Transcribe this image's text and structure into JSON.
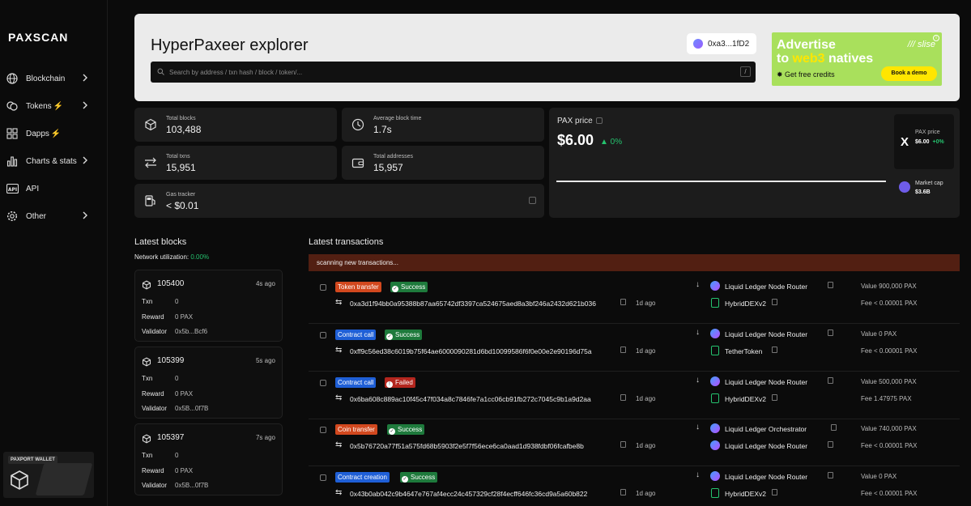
{
  "app": {
    "logo": "PAXSCAN"
  },
  "sidebar": {
    "items": [
      {
        "label": "Blockchain",
        "icon": "globe-icon",
        "bolt": "",
        "chevron": true
      },
      {
        "label": "Tokens",
        "icon": "coins-icon",
        "bolt": "⚡",
        "chevron": true
      },
      {
        "label": "Dapps",
        "icon": "grid-icon",
        "bolt": "⚡",
        "chevron": false
      },
      {
        "label": "Charts & stats",
        "icon": "bar-chart-icon",
        "bolt": "",
        "chevron": true
      },
      {
        "label": "API",
        "icon": "api-icon",
        "bolt": "",
        "chevron": false
      },
      {
        "label": "Other",
        "icon": "gear-icon",
        "bolt": "",
        "chevron": true
      }
    ],
    "promo_tag": "PAXPORT WALLET"
  },
  "header": {
    "title": "HyperPaxeer explorer",
    "search_placeholder": "Search by address / txn hash / block / token/...",
    "search_shortcut": "/",
    "wallet": "0xa3...1fD2"
  },
  "ad": {
    "line1": "Advertise",
    "line2_pre": "to ",
    "line2_hl": "web3",
    "line2_post": " natives",
    "brand": "/// slise",
    "credits": "✸ Get free credits",
    "button": "Book a demo"
  },
  "stats": {
    "total_blocks": {
      "label": "Total blocks",
      "value": "103,488"
    },
    "avg_block_time": {
      "label": "Average block time",
      "value": "1.7s"
    },
    "total_txns": {
      "label": "Total txns",
      "value": "15,951"
    },
    "total_addresses": {
      "label": "Total addresses",
      "value": "15,957"
    },
    "gas_tracker": {
      "label": "Gas tracker",
      "value": "< $0.01"
    }
  },
  "price": {
    "label": "PAX price",
    "value": "$6.00",
    "change": "▲ 0%",
    "mini_label": "PAX price",
    "mini_value": "$6.00",
    "mini_change": "+0%",
    "market_cap_label": "Market cap",
    "market_cap_value": "$3.6B"
  },
  "blocks": {
    "title": "Latest blocks",
    "util_label": "Network utilization:",
    "util_value": "0.00%",
    "txn_label": "Txn",
    "reward_label": "Reward",
    "validator_label": "Validator",
    "items": [
      {
        "number": "105400",
        "ago": "4s ago",
        "txn": "0",
        "reward": "0 PAX",
        "validator": "0x5b...Bcf6"
      },
      {
        "number": "105399",
        "ago": "5s ago",
        "txn": "0",
        "reward": "0 PAX",
        "validator": "0x5B...0f7B"
      },
      {
        "number": "105397",
        "ago": "7s ago",
        "txn": "0",
        "reward": "0 PAX",
        "validator": "0x5B...0f7B"
      }
    ]
  },
  "transactions": {
    "title": "Latest transactions",
    "scanning": "scanning new transactions...",
    "value_label": "Value",
    "fee_label": "Fee",
    "items": [
      {
        "type": "Token transfer",
        "type_color": "#d2481e",
        "status": "Success",
        "status_color": "#1e7a3c",
        "hash": "0xa3d1f94bb0a95388b87aa65742df3397ca524675aed8a3bf246a2432d621b036",
        "time": "1d ago",
        "from": "Liquid Ledger Node Router",
        "to": "HybridDEXv2",
        "to_icon": "contract",
        "value": "900,000 PAX",
        "fee": "< 0.00001 PAX"
      },
      {
        "type": "Contract call",
        "type_color": "#1f5fd6",
        "status": "Success",
        "status_color": "#1e7a3c",
        "hash": "0xff9c56ed38c6019b75f64ae6000090281d6bd10099586f6f0e00e2e90196d75a",
        "time": "1d ago",
        "from": "Liquid Ledger Node Router",
        "to": "TetherToken",
        "to_icon": "contract",
        "value": "0 PAX",
        "fee": "< 0.00001 PAX"
      },
      {
        "type": "Contract call",
        "type_color": "#1f5fd6",
        "status": "Failed",
        "status_color": "#b3261e",
        "hash": "0x6ba608c889ac10f45c47f034a8c7846fe7a1cc06cb91fb272c7045c9b1a9d2aa",
        "time": "1d ago",
        "from": "Liquid Ledger Node Router",
        "to": "HybridDEXv2",
        "to_icon": "contract",
        "value": "500,000 PAX",
        "fee": "1.47975 PAX"
      },
      {
        "type": "Coin transfer",
        "type_color": "#d2481e",
        "status": "Success",
        "status_color": "#1e7a3c",
        "hash": "0x5b76720a77f51a575fd68b5903f2e5f7f56ece6ca0aad1d938fdbf06fcafbe8b",
        "time": "1d ago",
        "from": "Liquid Ledger Orchestrator",
        "to": "Liquid Ledger Node Router",
        "to_icon": "avatar",
        "value": "740,000 PAX",
        "fee": "< 0.00001 PAX"
      },
      {
        "type": "Contract creation",
        "type_color": "#1f5fd6",
        "status": "Success",
        "status_color": "#1e7a3c",
        "hash": "0x43b0ab042c9b4647e767af4ecc24c457329cf28f4ecff646fc36cd9a5a60b822",
        "time": "1d ago",
        "from": "Liquid Ledger Node Router",
        "to": "HybridDEXv2",
        "to_icon": "contract",
        "value": "0 PAX",
        "fee": "< 0.00001 PAX"
      }
    ]
  }
}
